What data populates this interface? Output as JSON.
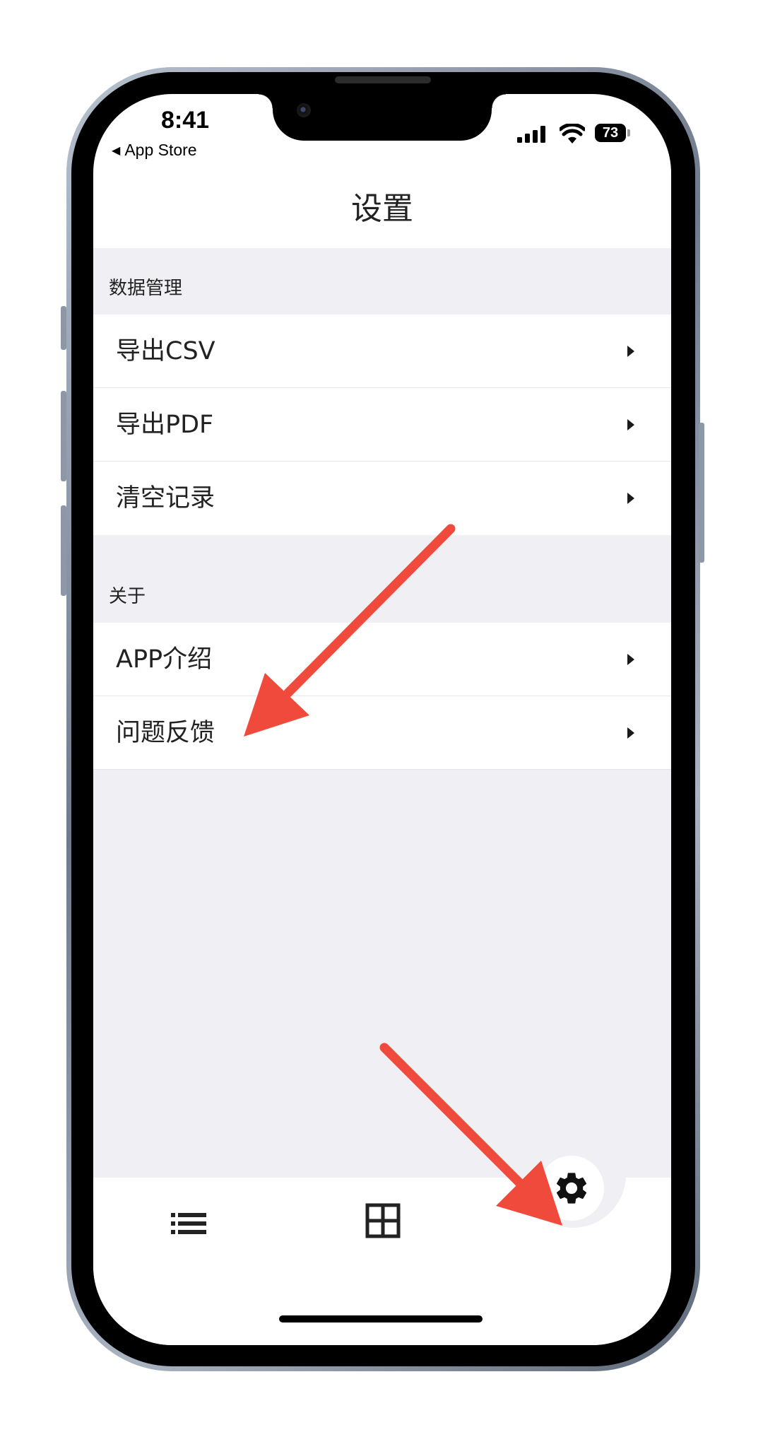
{
  "status_bar": {
    "time": "8:41",
    "back_label": "App Store",
    "battery_level": "73"
  },
  "nav": {
    "title": "设置"
  },
  "sections": [
    {
      "header": "数据管理",
      "items": [
        {
          "label": "导出CSV"
        },
        {
          "label": "导出PDF"
        },
        {
          "label": "清空记录"
        }
      ]
    },
    {
      "header": "关于",
      "items": [
        {
          "label": "APP介绍"
        },
        {
          "label": "问题反馈"
        }
      ]
    }
  ],
  "tab_bar": {
    "tabs": [
      {
        "icon": "list-icon",
        "selected": false
      },
      {
        "icon": "grid-icon",
        "selected": false
      },
      {
        "icon": "gear-icon",
        "selected": true
      }
    ]
  },
  "colors": {
    "background": "#f0f0f4",
    "row_background": "#ffffff",
    "annotation_arrow": "#f04a3c"
  }
}
